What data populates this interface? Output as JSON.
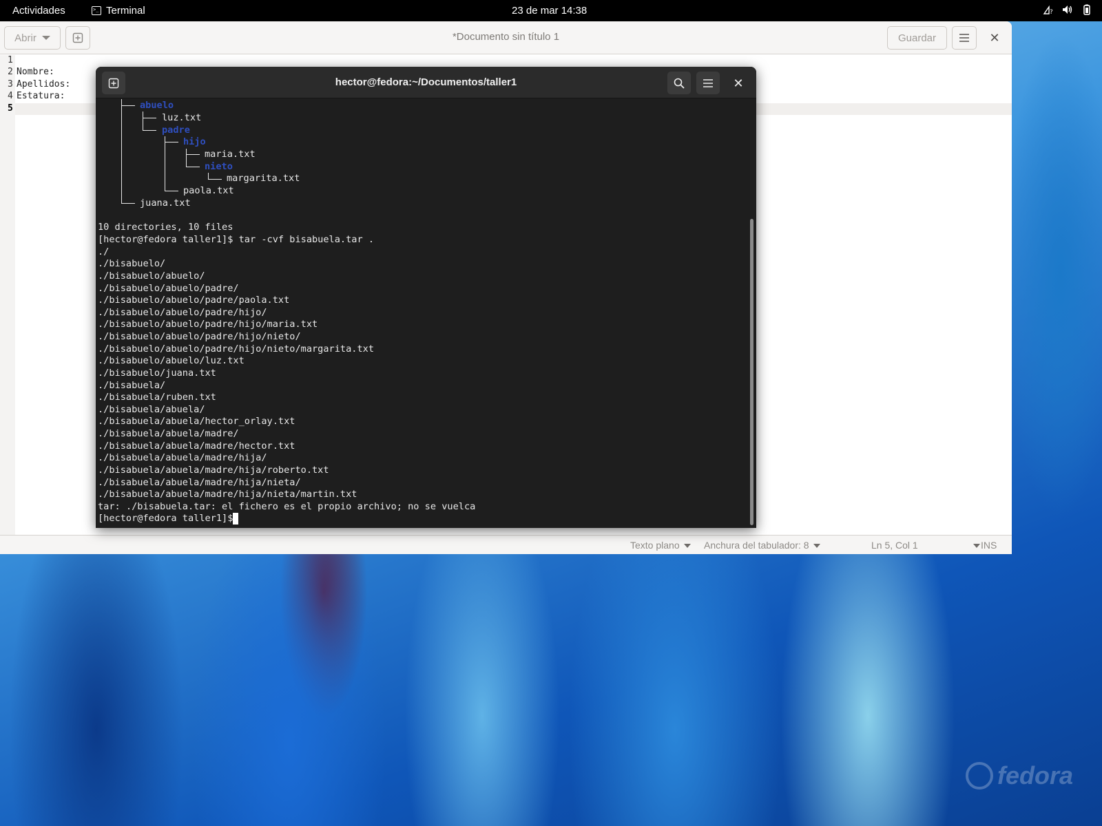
{
  "topbar": {
    "activities": "Actividades",
    "app_name": "Terminal",
    "clock": "23 de mar  14:38",
    "tray": [
      "network-icon",
      "volume-icon",
      "battery-icon"
    ]
  },
  "gedit": {
    "open_label": "Abrir",
    "save_label": "Guardar",
    "title": "*Documento sin título 1",
    "line_numbers": [
      "1",
      "2",
      "3",
      "4",
      "5"
    ],
    "lines": [
      "",
      "Nombre:",
      "Apellidos:",
      "Estatura:",
      ""
    ],
    "status": {
      "language": "Texto plano",
      "tab_width": "Anchura del tabulador: 8",
      "position": "Ln 5, Col 1",
      "mode": "INS"
    }
  },
  "terminal": {
    "title": "hector@fedora:~/Documentos/taller1",
    "tree": [
      {
        "text": "abuelo",
        "kind": "dir"
      },
      {
        "text": "luz.txt",
        "kind": "file"
      },
      {
        "text": "padre",
        "kind": "dir"
      },
      {
        "text": "hijo",
        "kind": "dir"
      },
      {
        "text": "maria.txt",
        "kind": "file"
      },
      {
        "text": "nieto",
        "kind": "dir"
      },
      {
        "text": "margarita.txt",
        "kind": "file"
      },
      {
        "text": "paola.txt",
        "kind": "file"
      },
      {
        "text": "juana.txt",
        "kind": "file"
      }
    ],
    "output": [
      "10 directories, 10 files",
      "[hector@fedora taller1]$ tar -cvf bisabuela.tar .",
      "./",
      "./bisabuelo/",
      "./bisabuelo/abuelo/",
      "./bisabuelo/abuelo/padre/",
      "./bisabuelo/abuelo/padre/paola.txt",
      "./bisabuelo/abuelo/padre/hijo/",
      "./bisabuelo/abuelo/padre/hijo/maria.txt",
      "./bisabuelo/abuelo/padre/hijo/nieto/",
      "./bisabuelo/abuelo/padre/hijo/nieto/margarita.txt",
      "./bisabuelo/abuelo/luz.txt",
      "./bisabuelo/juana.txt",
      "./bisabuela/",
      "./bisabuela/ruben.txt",
      "./bisabuela/abuela/",
      "./bisabuela/abuela/hector_orlay.txt",
      "./bisabuela/abuela/madre/",
      "./bisabuela/abuela/madre/hector.txt",
      "./bisabuela/abuela/madre/hija/",
      "./bisabuela/abuela/madre/hija/roberto.txt",
      "./bisabuela/abuela/madre/hija/nieta/",
      "./bisabuela/abuela/madre/hija/nieta/martin.txt",
      "tar: ./bisabuela.tar: el fichero es el propio archivo; no se vuelca",
      "[hector@fedora taller1]$ "
    ]
  },
  "wallpaper": {
    "logo_text": "fedora"
  }
}
